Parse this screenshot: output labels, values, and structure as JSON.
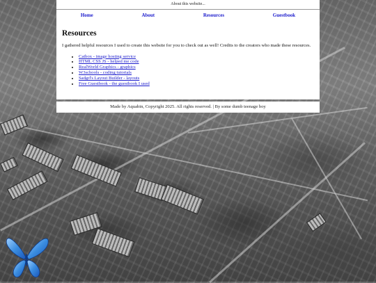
{
  "topbar": {
    "text": "About this website..."
  },
  "nav": {
    "items": [
      "Home",
      "About",
      "Resources",
      "Guestbook"
    ]
  },
  "main": {
    "heading": "Resources",
    "intro": "I gathered helpful resources I used to create this website for you to check out as well! Credits to the creators who made these resources.",
    "links": [
      "Catbox - image hosting service",
      "HTML CSS JS - helped me code",
      "RealWorld Graphics - graphics",
      "W3schools - coding tutorials",
      "Sadgrl's Layout Builder - layouts",
      "Free Guestbook - the guestbook I used"
    ]
  },
  "footer": {
    "text": "Made by Aquabin, Copyright 2025. All rights reserved. | By some dumb teenage boy"
  },
  "colors": {
    "link": "#1a1acc",
    "panel": "#ffffff",
    "butterfly": "#3a8de0"
  }
}
